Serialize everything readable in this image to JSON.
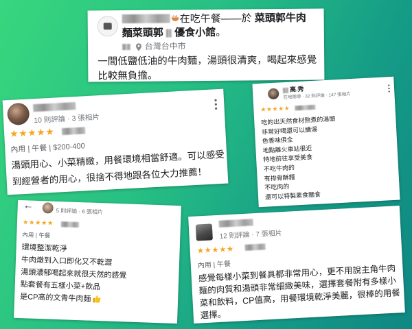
{
  "theme": {
    "background_start": "#38d67e",
    "background_end": "#0f8783",
    "card_background": "#ffffff",
    "star_color": "#f5a623",
    "text_color": "#202124",
    "muted_color": "#70757a"
  },
  "post": {
    "activity": "在吃午餐——於",
    "place_part1": "菜頭郭牛肉",
    "place_part2": "麵菜頭郭",
    "place_part3": "優食小館",
    "end_mark": "。",
    "location": "台灣台中市",
    "body_lines": [
      "一間低鹽低油的牛肉麵，湯頭很清爽，喝起來感覺",
      "比較無負擔。"
    ],
    "icons": {
      "activity": "bowl-icon",
      "location": "map-pin-icon"
    }
  },
  "reviews": [
    {
      "stats": "10 則評論 · 3 張相片",
      "rating": 5,
      "meta": "內用 | 午餐 | $200-400",
      "lines": [
        "湯頭用心、小菜精緻，用餐環境相當舒適。可以感受",
        "到經營者的用心，很捨不得地跟各位大力推薦！"
      ]
    },
    {
      "name": "高.秀",
      "stats": "在地嚮導 · 32 則評論 · 147 張相片",
      "rating": 5,
      "lines": [
        "吃的出天然食材熬煮的湯頭",
        "非常好喝還可以續湯",
        "色香味俱全",
        "地點離火車站很近",
        "特地前往享受美食",
        "不吃牛肉的",
        "有排骨酥麵",
        "不吃肉的",
        "還可以特製素食麵食"
      ]
    },
    {
      "stats": "5 則評論 · 6 張相片",
      "rating": 5,
      "meta": "內用 | 午餐",
      "back_icon": "←",
      "lines": [
        "環境整潔乾淨",
        "牛肉燉到入口即化又不乾澀",
        "湯頭濃郁喝起來就很天然的感覺",
        "點套餐有五樣小菜+飲品",
        "是CP高的文青牛肉麵"
      ],
      "end_icon": "thumbs-up-icon"
    },
    {
      "stats": "12 則評論 · 7 張相片",
      "rating": 5,
      "meta": "內用 | 午餐",
      "lines": [
        "感覺每樣小菜到餐具都非常用心，更不用說主角牛肉",
        "麵的肉質和湯頭非常細緻美味，選擇套餐附有多樣小",
        "菜和飲料，CP值高，用餐環境乾淨美麗，很棒的用餐",
        "選擇。"
      ]
    }
  ]
}
